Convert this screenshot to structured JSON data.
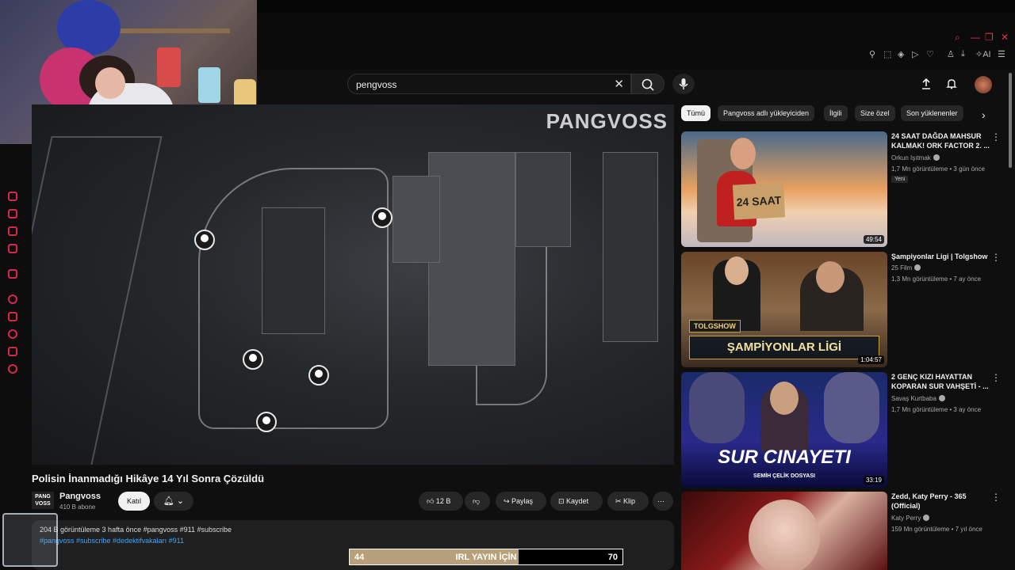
{
  "search": {
    "query": "pengvoss"
  },
  "video": {
    "watermark": "PANGVOSS",
    "title": "Polisin İnanmadığı Hikâye 14 Yıl Sonra Çözüldü"
  },
  "channel": {
    "avatar_text": "PANG VOSS",
    "name": "Pangvoss",
    "subscribers": "410 B abone",
    "join_label": "Katıl"
  },
  "actions": {
    "likes": "12 B",
    "share": "Paylaş",
    "save": "Kaydet",
    "clip": "Klip"
  },
  "description": {
    "line1": "204 B görüntüleme  3 hafta önce  #pangvoss #911 #subscribe",
    "line2": "#pangvoss  #subscribe #dedektifvakaları #911"
  },
  "goal_bar": {
    "left": "44",
    "label": "IRL YAYIN İÇİN",
    "right": "70",
    "progress": 0.62
  },
  "chips": [
    "Tümü",
    "Pangvoss adlı yükleyiciden",
    "İlgili",
    "Size özel",
    "Son yüklenenler"
  ],
  "recommendations": [
    {
      "title": "24 SAAT DAĞDA MAHSUR KALMAK! ORK FACTOR 2. ...",
      "channel": "Orkun Işıtmak",
      "meta": "1,7 Mn görüntüleme • 3 gün önce",
      "badge": "Yeni",
      "duration": "49:54",
      "thumb_text": "24 SAAT"
    },
    {
      "title": "Şampiyonlar Ligi | Tolgshow",
      "channel": "25 Film",
      "meta": "1,3 Mn görüntüleme • 7 ay önce",
      "duration": "1:04:57",
      "thumb_text": "ŞAMPİYONLAR LİGİ",
      "thumb_tag": "TOLGSHOW"
    },
    {
      "title": "2 GENÇ KIZI HAYATTAN KOPARAN SUR VAHŞETİ - ...",
      "channel": "Savaş Kurtbaba",
      "meta": "1,7 Mn görüntüleme • 3 ay önce",
      "duration": "33:19",
      "thumb_text": "SUR CINAYETI",
      "thumb_sub": "SEMİH ÇELİK DOSYASI"
    },
    {
      "title": "Zedd, Katy Perry - 365 (Official)",
      "channel": "Katy Perry",
      "meta": "159 Mn görüntüleme • 7 yıl önce"
    }
  ]
}
